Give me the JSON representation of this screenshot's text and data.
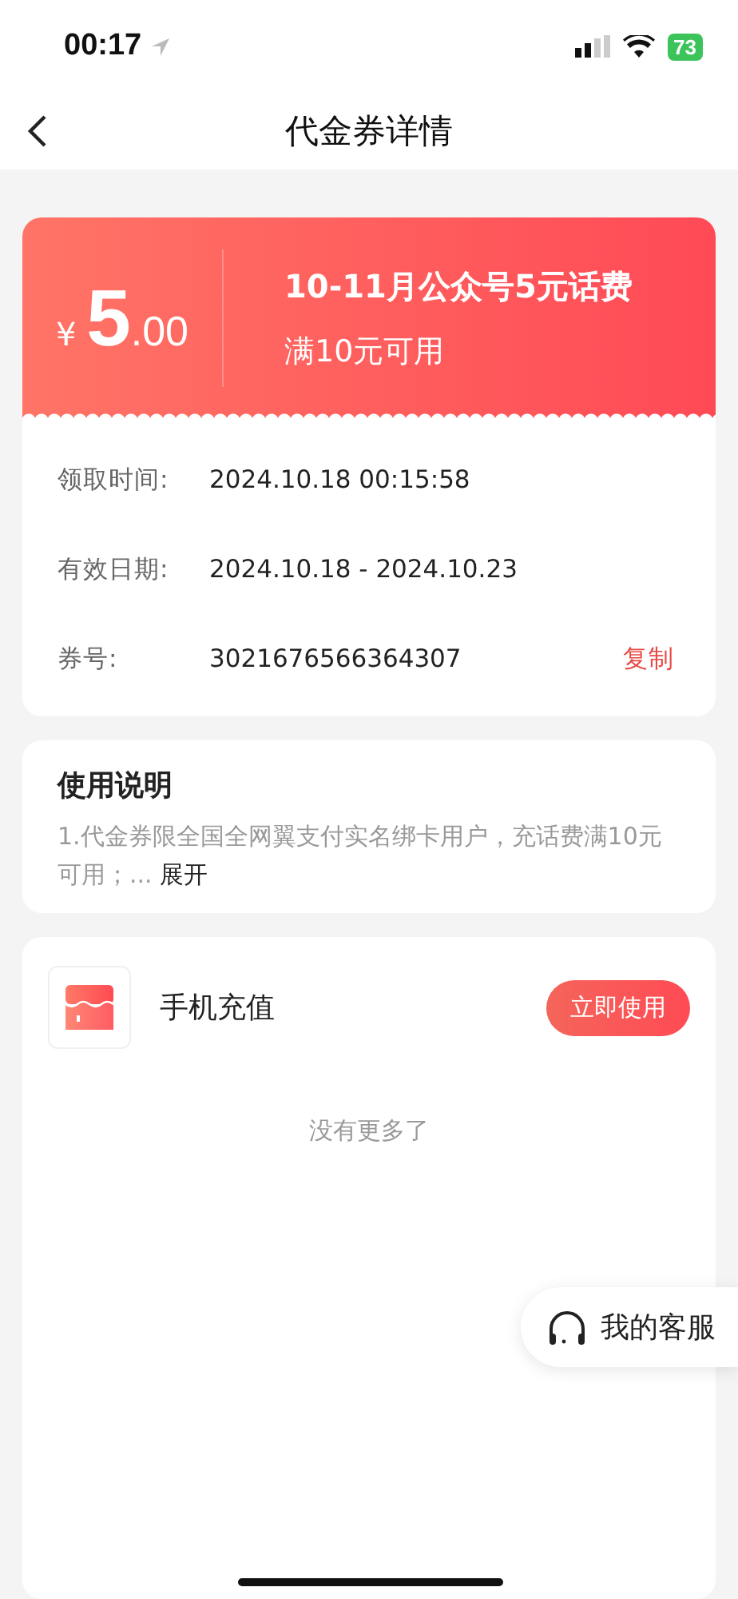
{
  "status_bar": {
    "time": "00:17",
    "battery": "73"
  },
  "nav": {
    "title": "代金券详情"
  },
  "coupon": {
    "currency": "¥",
    "integer": "5",
    "decimal": ".00",
    "name": "10-11月公众号5元话费",
    "condition": "满10元可用",
    "details": [
      {
        "label": "领取时间:",
        "value": "2024.10.18 00:15:58"
      },
      {
        "label": "有效日期:",
        "value": "2024.10.18 - 2024.10.23"
      },
      {
        "label": "券号:",
        "value": "3021676566364307",
        "action": "复制"
      }
    ]
  },
  "instructions": {
    "title": "使用说明",
    "text": "1.代金券限全国全网翼支付实名绑卡用户，充话费满10元可用；...",
    "expand": "展开"
  },
  "services": [
    {
      "name": "手机充值",
      "button": "立即使用"
    }
  ],
  "end_note": "没有更多了",
  "customer_service": "我的客服"
}
